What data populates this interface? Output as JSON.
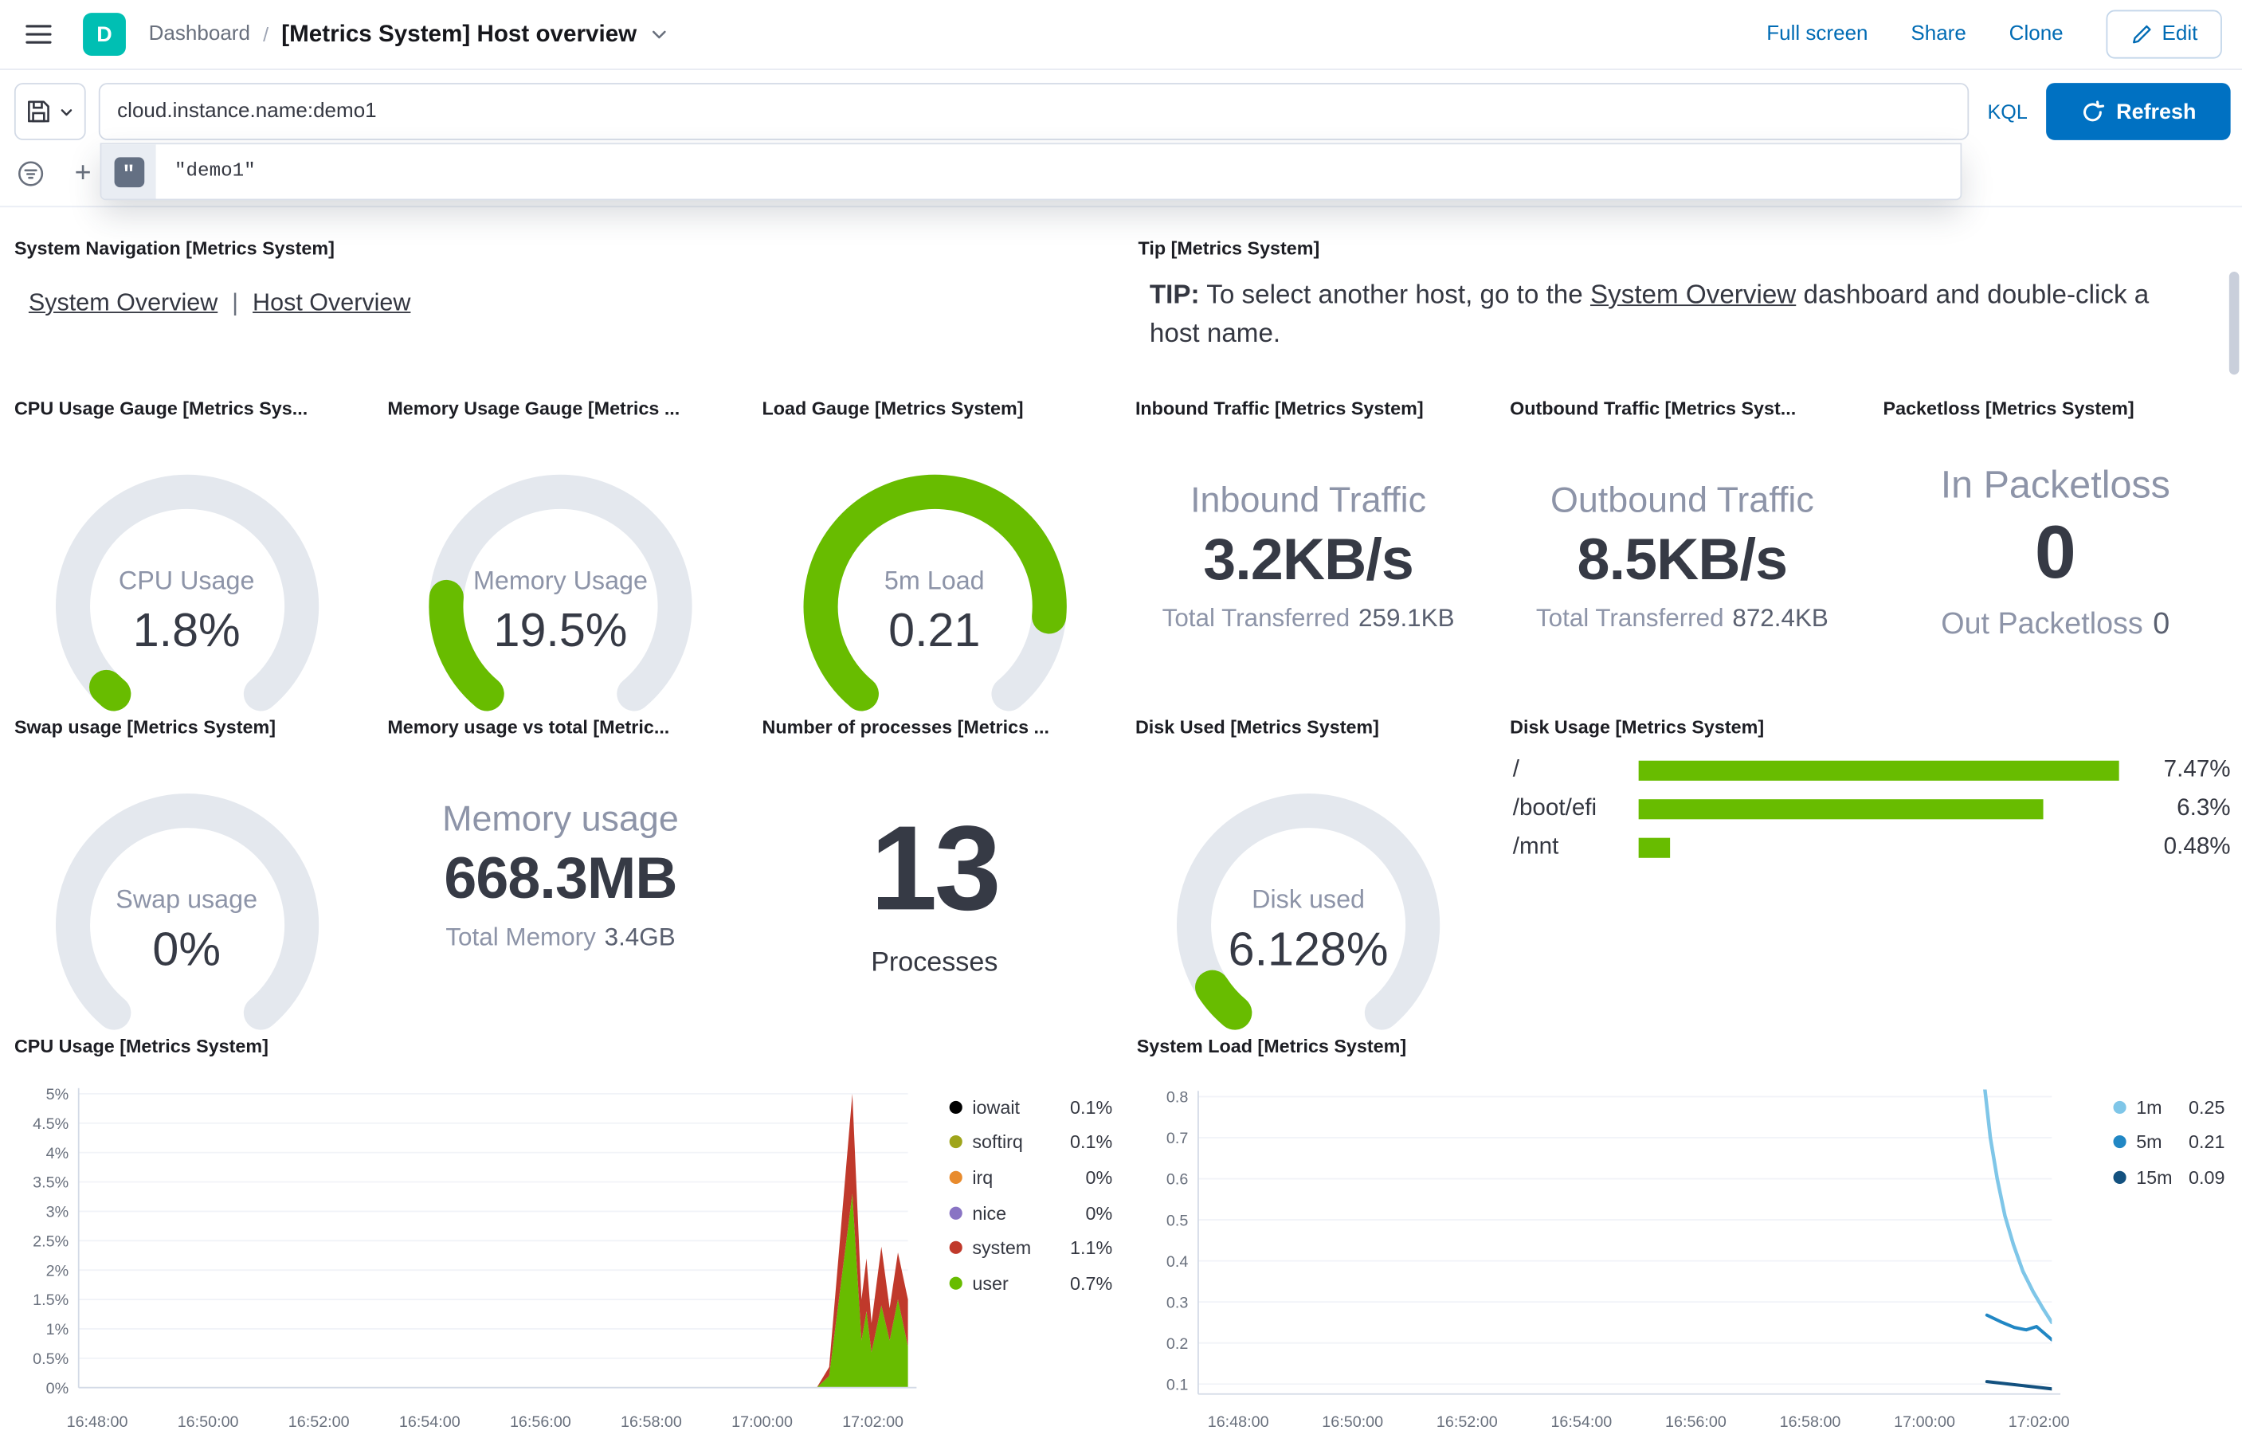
{
  "header": {
    "logo_letter": "D",
    "breadcrumb": {
      "root": "Dashboard",
      "separator": "/",
      "title": "[Metrics System] Host overview"
    },
    "actions": {
      "full_screen": "Full screen",
      "share": "Share",
      "clone": "Clone",
      "edit": "Edit"
    }
  },
  "query_bar": {
    "query": "cloud.instance.name:demo1",
    "language_label": "KQL",
    "refresh_label": "Refresh",
    "suggestion_text": "\"demo1\"",
    "add_filter_label": "+"
  },
  "colors": {
    "green": "#68BC00",
    "gauge_track": "#E4E8EE",
    "primary_blue": "#0071C2",
    "link_blue": "#006BB4",
    "teal_logo": "#00BFB3"
  },
  "panels": {
    "system_navigation": {
      "title": "System Navigation [Metrics System]",
      "links": [
        "System Overview",
        "Host Overview"
      ],
      "separator": "|"
    },
    "tip": {
      "title": "Tip [Metrics System]",
      "prefix": "TIP:",
      "before_link": " To select another host, go to the ",
      "link": "System Overview",
      "after_link": " dashboard and double-click a host name."
    },
    "cpu_gauge": {
      "title": "CPU Usage Gauge [Metrics Sys...",
      "label": "CPU Usage",
      "value": "1.8%",
      "fraction": 0.018
    },
    "memory_gauge": {
      "title": "Memory Usage Gauge [Metrics ...",
      "label": "Memory Usage",
      "value": "19.5%",
      "fraction": 0.195
    },
    "load_gauge": {
      "title": "Load Gauge [Metrics System]",
      "label": "5m Load",
      "value": "0.21",
      "fraction": 0.84
    },
    "inbound_traffic": {
      "title": "Inbound Traffic [Metrics System]",
      "label": "Inbound Traffic",
      "value": "3.2KB/s",
      "sub_label": "Total Transferred",
      "sub_value": "259.1KB"
    },
    "outbound_traffic": {
      "title": "Outbound Traffic [Metrics Syst...",
      "label": "Outbound Traffic",
      "value": "8.5KB/s",
      "sub_label": "Total Transferred",
      "sub_value": "872.4KB"
    },
    "packetloss": {
      "title": "Packetloss [Metrics System]",
      "in_label": "In Packetloss",
      "in_value": "0",
      "out_label": "Out Packetloss",
      "out_value": "0"
    },
    "swap_gauge": {
      "title": "Swap usage [Metrics System]",
      "label": "Swap usage",
      "value": "0%",
      "fraction": 0
    },
    "memory_vs_total": {
      "title": "Memory usage vs total [Metric...",
      "label": "Memory usage",
      "value": "668.3MB",
      "sub_label": "Total Memory",
      "sub_value": "3.4GB"
    },
    "processes": {
      "title": "Number of processes [Metrics ...",
      "value": "13",
      "label": "Processes"
    },
    "disk_used_gauge": {
      "title": "Disk Used [Metrics System]",
      "label": "Disk used",
      "value": "6.128%",
      "fraction": 0.061
    },
    "disk_usage": {
      "title": "Disk Usage [Metrics System]",
      "max_pct": 7.47,
      "rows": [
        {
          "label": "/",
          "pct": 7.47,
          "value": "7.47%"
        },
        {
          "label": "/boot/efi",
          "pct": 6.3,
          "value": "6.3%"
        },
        {
          "label": "/mnt",
          "pct": 0.48,
          "value": "0.48%"
        }
      ]
    }
  },
  "chart_data": [
    {
      "type": "area",
      "title": "CPU Usage [Metrics System]",
      "x_ticks": [
        "16:48:00",
        "16:50:00",
        "16:52:00",
        "16:54:00",
        "16:56:00",
        "16:58:00",
        "17:00:00",
        "17:02:00"
      ],
      "y_ticks": [
        "5%",
        "4.5%",
        "4%",
        "3.5%",
        "3%",
        "2.5%",
        "2%",
        "1.5%",
        "1%",
        "0.5%",
        "0%"
      ],
      "y_max": 5,
      "legend": [
        {
          "label": "iowait",
          "value": "0.1%",
          "color": "#000000"
        },
        {
          "label": "softirq",
          "value": "0.1%",
          "color": "#9fa51b"
        },
        {
          "label": "irq",
          "value": "0%",
          "color": "#e88b2d"
        },
        {
          "label": "nice",
          "value": "0%",
          "color": "#8974c4"
        },
        {
          "label": "system",
          "value": "1.1%",
          "color": "#c0392b"
        },
        {
          "label": "user",
          "value": "0.7%",
          "color": "#68bc00"
        }
      ],
      "stacked_series": {
        "x": [
          0,
          0.89,
          0.905,
          0.933,
          0.944,
          0.95,
          0.956,
          0.968,
          0.978,
          0.988,
          1.0
        ],
        "user": [
          0,
          0,
          0.2,
          3.3,
          0.8,
          1.3,
          0.6,
          1.4,
          0.8,
          1.5,
          0.7
        ],
        "total": [
          0,
          0,
          0.35,
          5.0,
          1.5,
          2.2,
          1.1,
          2.4,
          1.35,
          2.3,
          1.5
        ]
      }
    },
    {
      "type": "line",
      "title": "System Load [Metrics System]",
      "x_ticks": [
        "16:48:00",
        "16:50:00",
        "16:52:00",
        "16:54:00",
        "16:56:00",
        "16:58:00",
        "17:00:00",
        "17:02:00"
      ],
      "y_ticks": [
        "0.8",
        "0.7",
        "0.6",
        "0.5",
        "0.4",
        "0.3",
        "0.2",
        "0.1"
      ],
      "legend": [
        {
          "label": "1m",
          "value": "0.25",
          "color": "#7fc6e8"
        },
        {
          "label": "5m",
          "value": "0.21",
          "color": "#2187c4"
        },
        {
          "label": "15m",
          "value": "0.09",
          "color": "#13517f"
        }
      ],
      "series": [
        {
          "name": "1m",
          "color": "#7fc6e8",
          "width": 2.5,
          "points": [
            [
              0.921,
              0.83
            ],
            [
              0.928,
              0.7
            ],
            [
              0.936,
              0.6
            ],
            [
              0.945,
              0.51
            ],
            [
              0.955,
              0.44
            ],
            [
              0.966,
              0.375
            ],
            [
              0.978,
              0.325
            ],
            [
              0.99,
              0.283
            ],
            [
              1.0,
              0.25
            ]
          ]
        },
        {
          "name": "5m",
          "color": "#2187c4",
          "width": 2.25,
          "points": [
            [
              0.924,
              0.268
            ],
            [
              0.94,
              0.252
            ],
            [
              0.956,
              0.238
            ],
            [
              0.97,
              0.232
            ],
            [
              0.982,
              0.24
            ],
            [
              1.0,
              0.208
            ]
          ]
        },
        {
          "name": "15m",
          "color": "#13517f",
          "width": 2.25,
          "points": [
            [
              0.924,
              0.106
            ],
            [
              0.95,
              0.1
            ],
            [
              0.975,
              0.094
            ],
            [
              1.0,
              0.088
            ]
          ]
        }
      ]
    }
  ]
}
